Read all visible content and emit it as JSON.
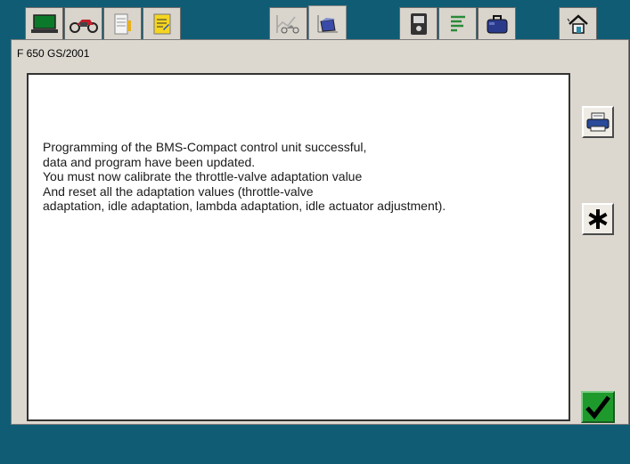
{
  "header": {
    "model_label": "F 650 GS/2001"
  },
  "tabs": [
    {
      "icon": "laptop-icon"
    },
    {
      "icon": "motorcycle-icon"
    },
    {
      "icon": "document-list-icon"
    },
    {
      "icon": "notepad-icon"
    },
    {
      "icon": "bike-chart-icon"
    },
    {
      "icon": "programming-icon"
    },
    {
      "icon": "diagnosis-device-icon"
    },
    {
      "icon": "text-list-icon"
    },
    {
      "icon": "toolbox-icon"
    },
    {
      "icon": "home-icon"
    }
  ],
  "message": {
    "lines": [
      "Programming of the BMS-Compact control unit successful,",
      "data and program have been updated.",
      "You must now calibrate the throttle-valve adaptation value",
      "And reset all the adaptation values (throttle-valve",
      "adaptation, idle adaptation, lambda adaptation, idle actuator adjustment)."
    ]
  },
  "buttons": {
    "print": "printer-icon",
    "star": "asterisk-icon",
    "ok": "checkmark-icon"
  },
  "colors": {
    "background": "#0f5c74",
    "panel": "#dcd8d0",
    "ok_green": "#1e9a2c"
  }
}
